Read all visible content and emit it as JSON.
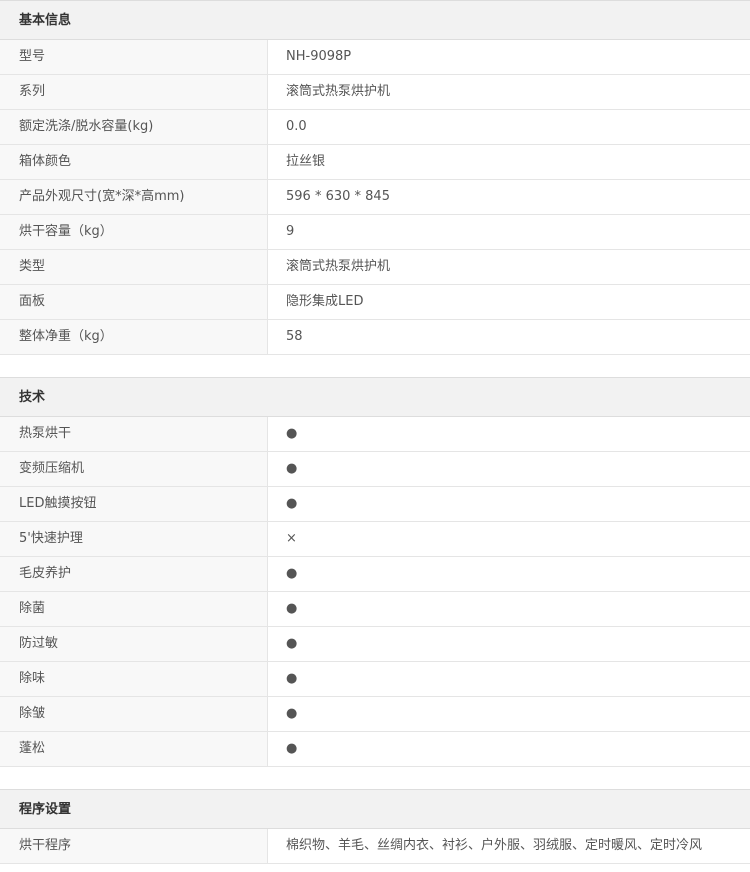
{
  "sections": [
    {
      "title": "基本信息",
      "rows": [
        {
          "label": "型号",
          "value": "NH-9098P"
        },
        {
          "label": "系列",
          "value": "滚筒式热泵烘护机"
        },
        {
          "label": "额定洗涤/脱水容量(kg)",
          "value": "0.0"
        },
        {
          "label": "箱体颜色",
          "value": "拉丝银"
        },
        {
          "label": "产品外观尺寸(宽*深*高mm)",
          "value": "596 * 630 * 845"
        },
        {
          "label": "烘干容量（kg）",
          "value": "9"
        },
        {
          "label": "类型",
          "value": "滚筒式热泵烘护机"
        },
        {
          "label": "面板",
          "value": "隐形集成LED"
        },
        {
          "label": "整体净重（kg）",
          "value": "58"
        }
      ]
    },
    {
      "title": "技术",
      "rows": [
        {
          "label": "热泵烘干",
          "value": "●"
        },
        {
          "label": "变频压缩机",
          "value": "●"
        },
        {
          "label": "LED触摸按钮",
          "value": "●"
        },
        {
          "label": "5'快速护理",
          "value": "×"
        },
        {
          "label": "毛皮养护",
          "value": "●"
        },
        {
          "label": "除菌",
          "value": "●"
        },
        {
          "label": "防过敏",
          "value": "●"
        },
        {
          "label": "除味",
          "value": "●"
        },
        {
          "label": "除皱",
          "value": "●"
        },
        {
          "label": "蓬松",
          "value": "●"
        }
      ]
    },
    {
      "title": "程序设置",
      "rows": [
        {
          "label": "烘干程序",
          "value": "棉织物、羊毛、丝绸内衣、衬衫、户外服、羽绒服、定时暖风、定时冷风"
        }
      ]
    }
  ]
}
